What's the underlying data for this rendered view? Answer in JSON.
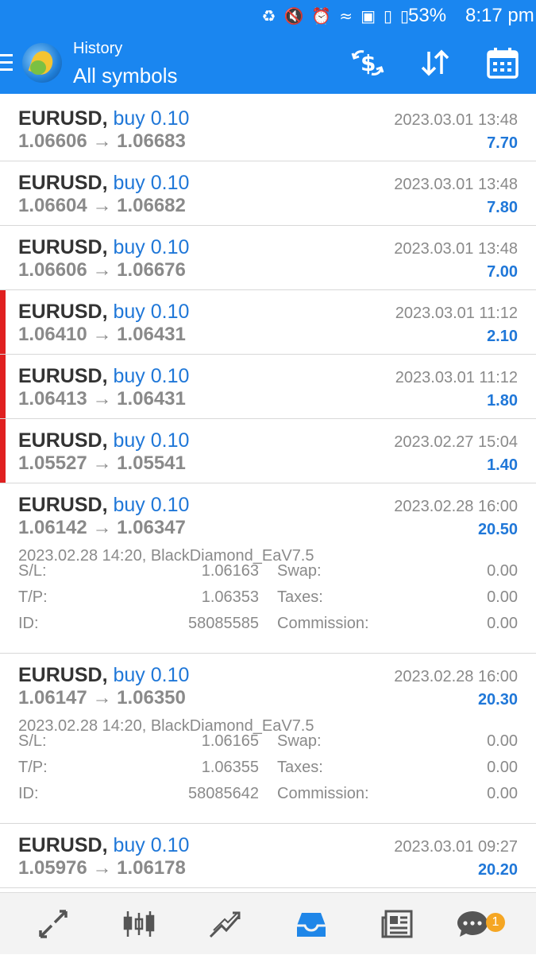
{
  "status_bar": {
    "battery": "53%",
    "time": "8:17 pm",
    "icons": [
      "battery-saver-icon",
      "mute-icon",
      "alarm-icon",
      "wifi-icon",
      "sim-icon",
      "signal-icon",
      "signal-icon"
    ]
  },
  "toolbar": {
    "title": "History",
    "subtitle": "All symbols",
    "icons": [
      "currency-swap-icon",
      "sort-icon",
      "calendar-icon"
    ]
  },
  "trades": [
    {
      "symbol": "EURUSD,",
      "side": "buy 0.10",
      "open": "1.06606",
      "arrow": "→",
      "close": "1.06683",
      "time": "2023.03.01 13:48",
      "profit": "7.70",
      "marked": false
    },
    {
      "symbol": "EURUSD,",
      "side": "buy 0.10",
      "open": "1.06604",
      "arrow": "→",
      "close": "1.06682",
      "time": "2023.03.01 13:48",
      "profit": "7.80",
      "marked": false
    },
    {
      "symbol": "EURUSD,",
      "side": "buy 0.10",
      "open": "1.06606",
      "arrow": "→",
      "close": "1.06676",
      "time": "2023.03.01 13:48",
      "profit": "7.00",
      "marked": false
    },
    {
      "symbol": "EURUSD,",
      "side": "buy 0.10",
      "open": "1.06410",
      "arrow": "→",
      "close": "1.06431",
      "time": "2023.03.01 11:12",
      "profit": "2.10",
      "marked": true
    },
    {
      "symbol": "EURUSD,",
      "side": "buy 0.10",
      "open": "1.06413",
      "arrow": "→",
      "close": "1.06431",
      "time": "2023.03.01 11:12",
      "profit": "1.80",
      "marked": true
    },
    {
      "symbol": "EURUSD,",
      "side": "buy 0.10",
      "open": "1.05527",
      "arrow": "→",
      "close": "1.05541",
      "time": "2023.02.27 15:04",
      "profit": "1.40",
      "marked": true
    },
    {
      "symbol": "EURUSD,",
      "side": "buy 0.10",
      "open": "1.06142",
      "arrow": "→",
      "close": "1.06347",
      "time": "2023.02.28 16:00",
      "profit": "20.50",
      "marked": false,
      "details": {
        "comment": "2023.02.28 14:20, BlackDiamond_EaV7.5",
        "sl_label": "S/L:",
        "sl": "1.06163",
        "tp_label": "T/P:",
        "tp": "1.06353",
        "id_label": "ID:",
        "id": "58085585",
        "swap_label": "Swap:",
        "swap": "0.00",
        "taxes_label": "Taxes:",
        "taxes": "0.00",
        "commission_label": "Commission:",
        "commission": "0.00"
      }
    },
    {
      "symbol": "EURUSD,",
      "side": "buy 0.10",
      "open": "1.06147",
      "arrow": "→",
      "close": "1.06350",
      "time": "2023.02.28 16:00",
      "profit": "20.30",
      "marked": false,
      "details": {
        "comment": "2023.02.28 14:20, BlackDiamond_EaV7.5",
        "sl_label": "S/L:",
        "sl": "1.06165",
        "tp_label": "T/P:",
        "tp": "1.06355",
        "id_label": "ID:",
        "id": "58085642",
        "swap_label": "Swap:",
        "swap": "0.00",
        "taxes_label": "Taxes:",
        "taxes": "0.00",
        "commission_label": "Commission:",
        "commission": "0.00"
      }
    },
    {
      "symbol": "EURUSD,",
      "side": "buy 0.10",
      "open": "1.05976",
      "arrow": "→",
      "close": "1.06178",
      "time": "2023.03.01 09:27",
      "profit": "20.20",
      "marked": false
    }
  ],
  "bottom_nav": {
    "items": [
      "quotes-icon",
      "chart-icon",
      "trade-icon",
      "history-icon",
      "news-icon",
      "chat-icon"
    ],
    "active": "history-icon",
    "chat_badge": "1"
  },
  "colors": {
    "accent": "#1a86f0",
    "side_blue": "#1f77d8",
    "loss_marker": "#e02020",
    "badge": "#f5a623"
  }
}
